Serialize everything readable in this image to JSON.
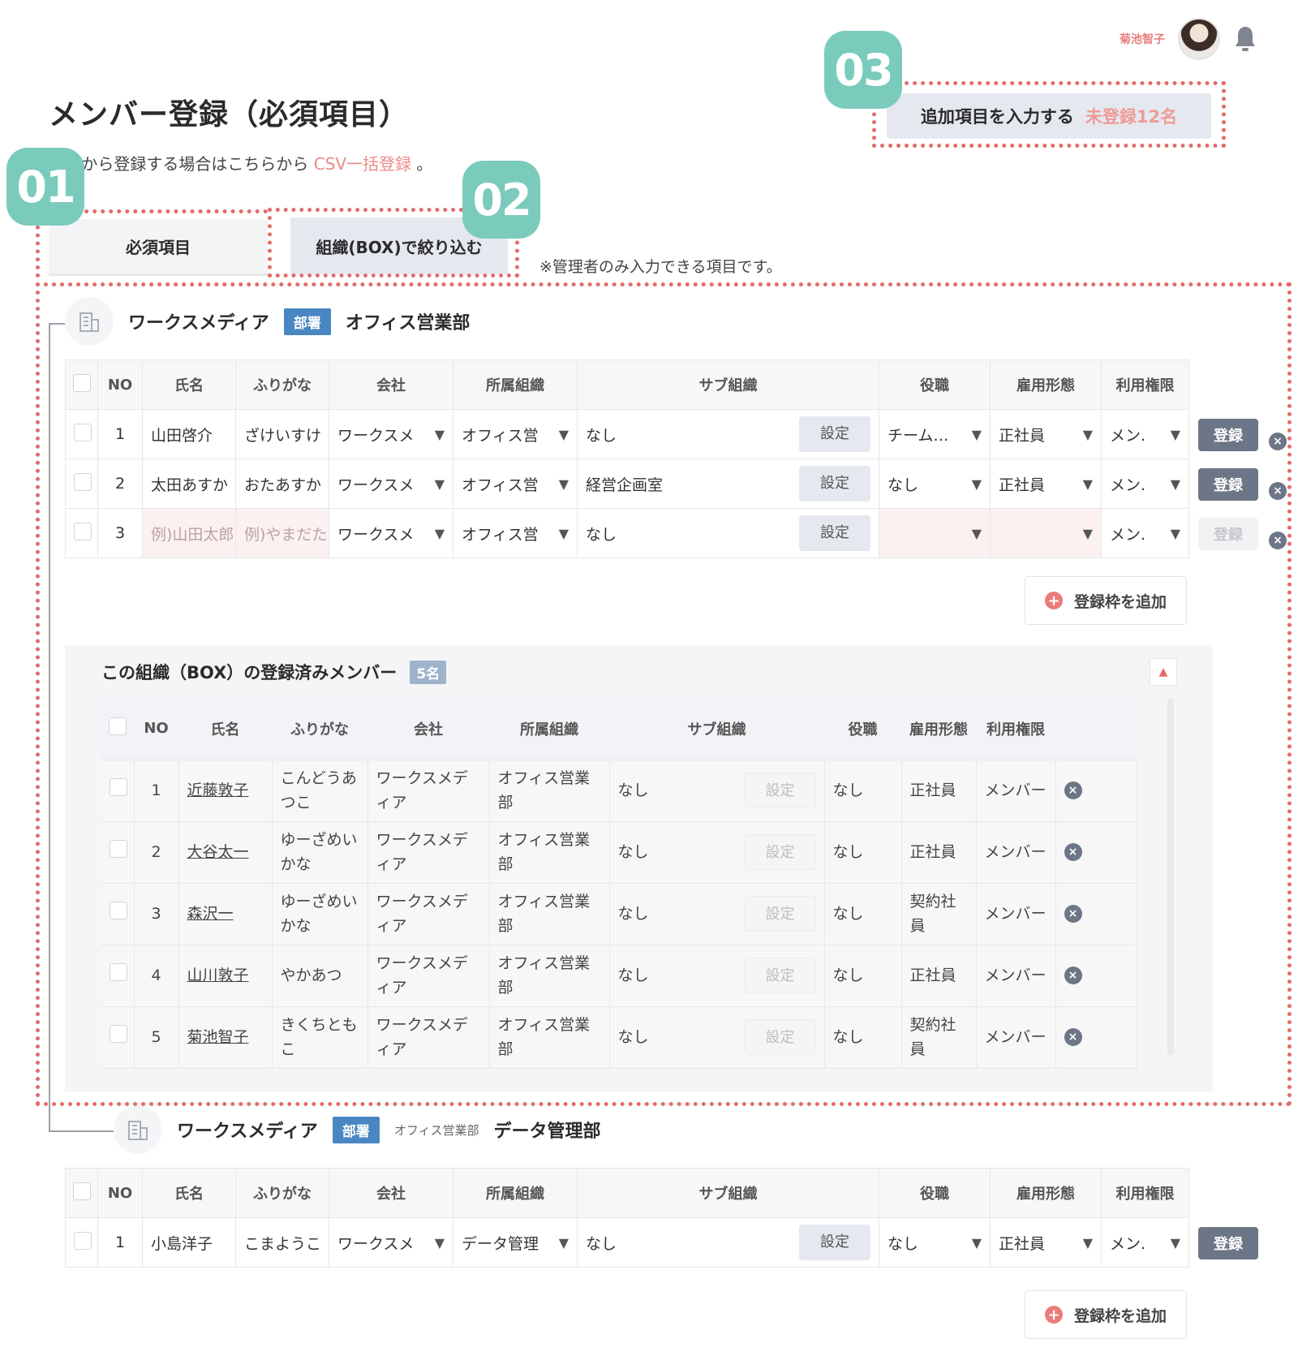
{
  "header": {
    "user_name": "菊池智子",
    "avatar_icon": "user-avatar",
    "bell_icon": "bell-icon"
  },
  "page": {
    "title": "メンバー登録（必須項目）",
    "csv_prefix": "CSVから登録する場合はこちらから",
    "csv_link": "CSV一括登録",
    "csv_suffix": "。"
  },
  "markers": {
    "m1": "01",
    "m2": "02",
    "m3": "03"
  },
  "additional": {
    "label": "追加項目を入力する",
    "count": "未登録12名"
  },
  "tabs": {
    "required": "必須項目",
    "org": "組織(BOX)で絞り込む",
    "note": "※管理者のみ入力できる項目です。"
  },
  "columns": [
    "NO",
    "氏名",
    "ふりがな",
    "会社",
    "所属組織",
    "サブ組織",
    "役職",
    "雇用形態",
    "利用権限"
  ],
  "group1": {
    "company": "ワークスメディア",
    "badge": "部署",
    "dept": "オフィス営業部",
    "rows": [
      {
        "no": "1",
        "name": "山田啓介",
        "kana": "ざけいすけ",
        "company": "ワークスメ",
        "org": "オフィス営",
        "sub": "なし",
        "set": "設定",
        "title": "チーム…",
        "employment": "正社員",
        "perm": "メン.",
        "reg": "登録"
      },
      {
        "no": "2",
        "name": "太田あすか",
        "kana": "おたあすか",
        "company": "ワークスメ",
        "org": "オフィス営",
        "sub": "経営企画室",
        "set": "設定",
        "title": "なし",
        "employment": "正社員",
        "perm": "メン.",
        "reg": "登録"
      },
      {
        "no": "3",
        "name": "例)山田太郎",
        "kana": "例)やまだた",
        "company": "ワークスメ",
        "org": "オフィス営",
        "sub": "なし",
        "set": "設定",
        "title": "",
        "employment": "",
        "perm": "メン.",
        "reg": "登録"
      }
    ],
    "add_label": "登録枠を追加"
  },
  "members": {
    "title": "この組織（BOX）の登録済みメンバー",
    "count": "5名",
    "columns": [
      "NO",
      "氏名",
      "ふりがな",
      "会社",
      "所属組織",
      "サブ組織",
      "役職",
      "雇用形態",
      "利用権限"
    ],
    "rows": [
      {
        "no": "1",
        "name": "近藤敦子",
        "kana": "こんどうあつこ",
        "company": "ワークスメディア",
        "org": "オフィス営業部",
        "sub": "なし",
        "set": "設定",
        "title": "なし",
        "employment": "正社員",
        "perm": "メンバー"
      },
      {
        "no": "2",
        "name": "大谷太一",
        "kana": "ゆーざめいかな",
        "company": "ワークスメディア",
        "org": "オフィス営業部",
        "sub": "なし",
        "set": "設定",
        "title": "なし",
        "employment": "正社員",
        "perm": "メンバー"
      },
      {
        "no": "3",
        "name": "森沢一",
        "kana": "ゆーざめいかな",
        "company": "ワークスメディア",
        "org": "オフィス営業部",
        "sub": "なし",
        "set": "設定",
        "title": "なし",
        "employment": "契約社員",
        "perm": "メンバー"
      },
      {
        "no": "4",
        "name": "山川敦子",
        "kana": "やかあつ",
        "company": "ワークスメディア",
        "org": "オフィス営業部",
        "sub": "なし",
        "set": "設定",
        "title": "なし",
        "employment": "正社員",
        "perm": "メンバー"
      },
      {
        "no": "5",
        "name": "菊池智子",
        "kana": "きくちともこ",
        "company": "ワークスメディア",
        "org": "オフィス営業部",
        "sub": "なし",
        "set": "設定",
        "title": "なし",
        "employment": "契約社員",
        "perm": "メンバー"
      }
    ]
  },
  "group2": {
    "company": "ワークスメディア",
    "badge": "部署",
    "parent": "オフィス営業部",
    "dept": "データ管理部",
    "rows": [
      {
        "no": "1",
        "name": "小島洋子",
        "kana": "こまようこ",
        "company": "ワークスメ",
        "org": "データ管理",
        "sub": "なし",
        "set": "設定",
        "title": "なし",
        "employment": "正社員",
        "perm": "メン.",
        "reg": "登録"
      }
    ],
    "add_label": "登録枠を追加"
  },
  "colors": {
    "accent_red": "#e46b6b",
    "marker_teal": "#7bcbbd",
    "dept_blue": "#4a87c2",
    "button_gray": "#6d7686"
  }
}
